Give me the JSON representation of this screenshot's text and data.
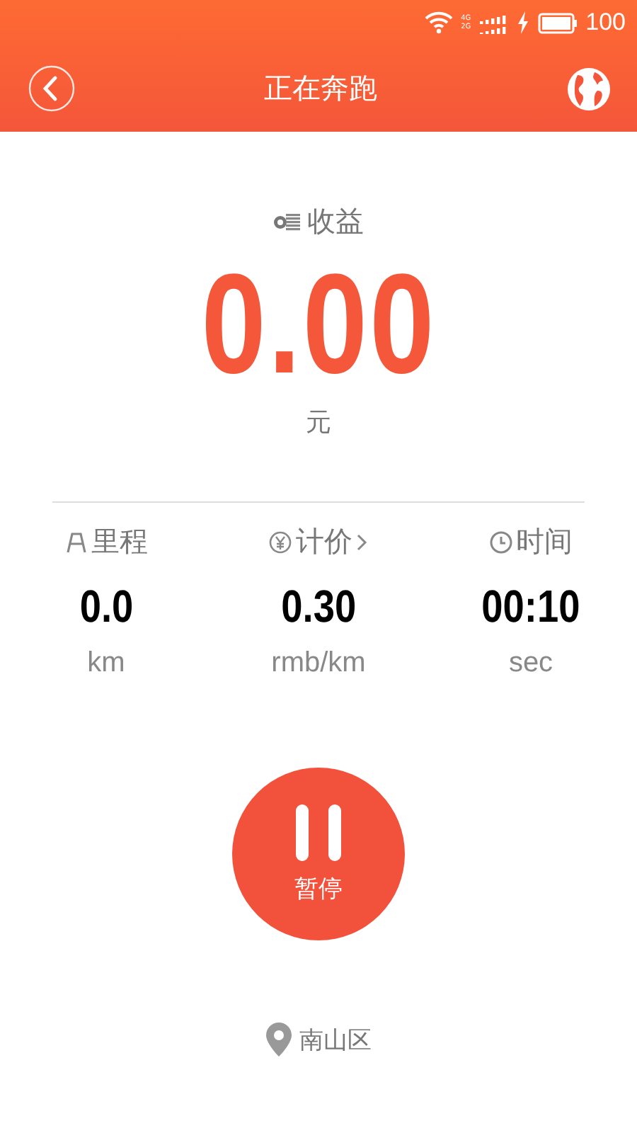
{
  "status_bar": {
    "network_top": "4G",
    "network_bottom": "2G",
    "battery": "100"
  },
  "nav": {
    "title": "正在奔跑"
  },
  "earnings": {
    "label": "收益",
    "value": "0.00",
    "unit": "元"
  },
  "stats": [
    {
      "kind": "distance",
      "label": "里程",
      "value": "0.0",
      "unit": "km",
      "expandable": false
    },
    {
      "kind": "price",
      "label": "计价",
      "value": "0.30",
      "unit": "rmb/km",
      "expandable": true
    },
    {
      "kind": "time",
      "label": "时间",
      "value": "00:10",
      "unit": "sec",
      "expandable": false
    }
  ],
  "pause_button": {
    "label": "暂停"
  },
  "location": {
    "text": "南山区"
  }
}
